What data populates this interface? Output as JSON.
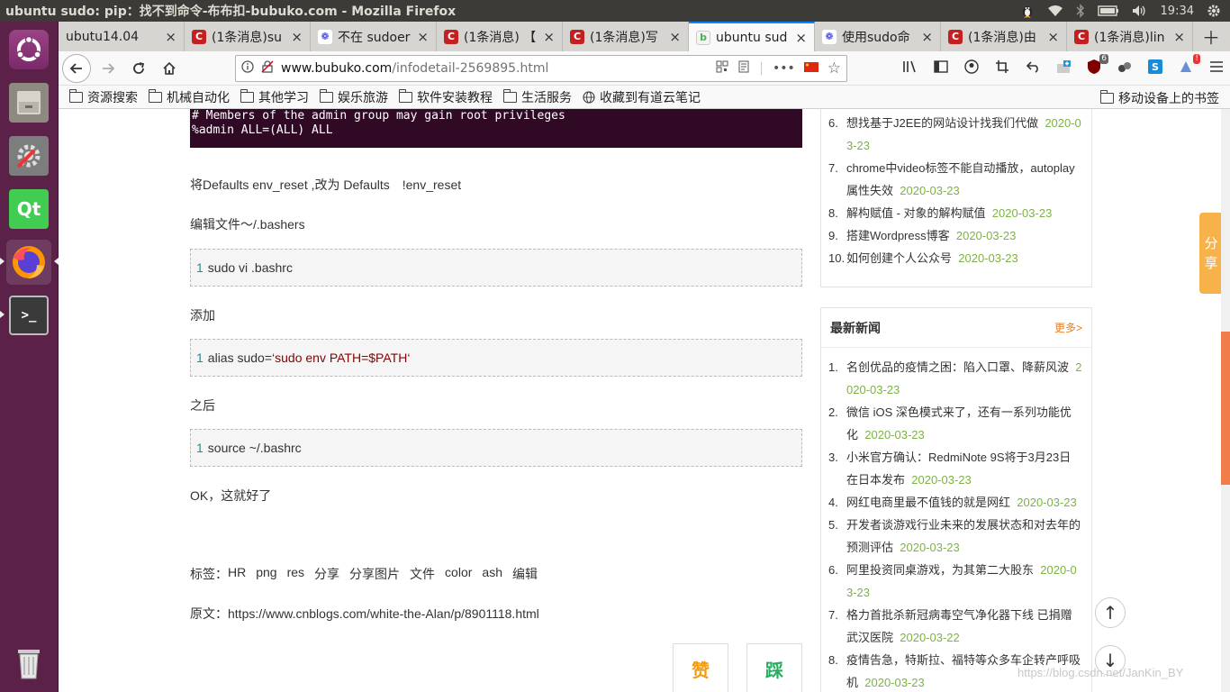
{
  "window_title": "ubuntu sudo: pip：找不到命令-布布扣-bubuko.com - Mozilla Firefox",
  "panel": {
    "time": "19:34"
  },
  "tabs": [
    {
      "title": "ubutu14.04",
      "icon": "none"
    },
    {
      "title": "(1条消息)su",
      "icon": "csdn"
    },
    {
      "title": "不在 sudoer",
      "icon": "baidu"
    },
    {
      "title": "(1条消息) 【",
      "icon": "csdn"
    },
    {
      "title": "(1条消息)写",
      "icon": "csdn"
    },
    {
      "title": "ubuntu sud",
      "icon": "bubuko",
      "active": true
    },
    {
      "title": "使用sudo命",
      "icon": "baidu"
    },
    {
      "title": "(1条消息)由",
      "icon": "csdn"
    },
    {
      "title": "(1条消息)lin",
      "icon": "csdn"
    }
  ],
  "url": {
    "host": "www.bubuko.com",
    "path": "/infodetail-2569895.html"
  },
  "addon_badge": "6",
  "bookmarks": [
    "资源搜索",
    "机械自动化",
    "其他学习",
    "娱乐旅游",
    "软件安装教程",
    "生活服务"
  ],
  "bookmark_youdao": "收藏到有道云笔记",
  "bookmark_mobile": "移动设备上的书签",
  "article": {
    "terminal_lines": [
      "# Members of the admin group may gain root privileges",
      "%admin ALL=(ALL) ALL"
    ],
    "p1": "将Defaults env_reset ,改为 Defaults　!env_reset",
    "p2": " 编辑文件～/.bashers",
    "code1_ln": "1",
    "code1": "sudo vi  .bashrc",
    "p3": "添加",
    "code2_ln": "1",
    "code2_pre": "alias sudo=",
    "code2_str": "‘sudo env PATH=$PATH‘",
    "p4": "之后",
    "code3_ln": "1",
    "code3": "source ~/.bashrc",
    "p5": "OK，这就好了",
    "tags_label": "标签：",
    "tags": [
      "HR",
      "png",
      "res",
      "分享",
      "分享图片",
      "文件",
      "color",
      "ash",
      "编辑"
    ],
    "source_label": "原文：",
    "source_url": "https://www.cnblogs.com/white-the-Alan/p/8901118.html",
    "like": "赞",
    "dislike": "踩"
  },
  "sidebar_top": [
    {
      "num": "6.",
      "text": "想找基于J2EE的网站设计找我们代做",
      "date": "2020-03-23"
    },
    {
      "num": "7.",
      "text": "chrome中video标签不能自动播放，autoplay属性失效",
      "date": "2020-03-23"
    },
    {
      "num": "8.",
      "text": "解构赋值 - 对象的解构赋值",
      "date": "2020-03-23"
    },
    {
      "num": "9.",
      "text": "搭建Wordpress博客",
      "date": "2020-03-23"
    },
    {
      "num": "10.",
      "text": "如何创建个人公众号",
      "date": "2020-03-23"
    }
  ],
  "news": {
    "title": "最新新闻",
    "more": "更多>",
    "items": [
      {
        "num": "1.",
        "text": "名创优品的疫情之困：陷入口罩、降薪风波",
        "date": "2020-03-23"
      },
      {
        "num": "2.",
        "text": "微信 iOS 深色模式来了，还有一系列功能优化",
        "date": "2020-03-23"
      },
      {
        "num": "3.",
        "text": "小米官方确认：RedmiNote 9S将于3月23日在日本发布",
        "date": "2020-03-23"
      },
      {
        "num": "4.",
        "text": "网红电商里最不值钱的就是网红",
        "date": "2020-03-23"
      },
      {
        "num": "5.",
        "text": "开发者谈游戏行业未来的发展状态和对去年的预测评估",
        "date": "2020-03-23"
      },
      {
        "num": "6.",
        "text": "阿里投资同桌游戏，为其第二大股东",
        "date": "2020-03-23"
      },
      {
        "num": "7.",
        "text": "格力首批杀新冠病毒空气净化器下线 已捐赠武汉医院",
        "date": "2020-03-22"
      },
      {
        "num": "8.",
        "text": "疫情告急，特斯拉、福特等众多车企转产呼吸机",
        "date": "2020-03-23"
      }
    ]
  },
  "share_tab": "分享",
  "watermark": "https://blog.csdn.net/JanKin_BY",
  "colors": {
    "accent": "#0a84ff",
    "terminal_bg": "#300a24",
    "launcher": "#5b2149",
    "date_green": "#7cb342",
    "more_orange": "#e67e22"
  }
}
